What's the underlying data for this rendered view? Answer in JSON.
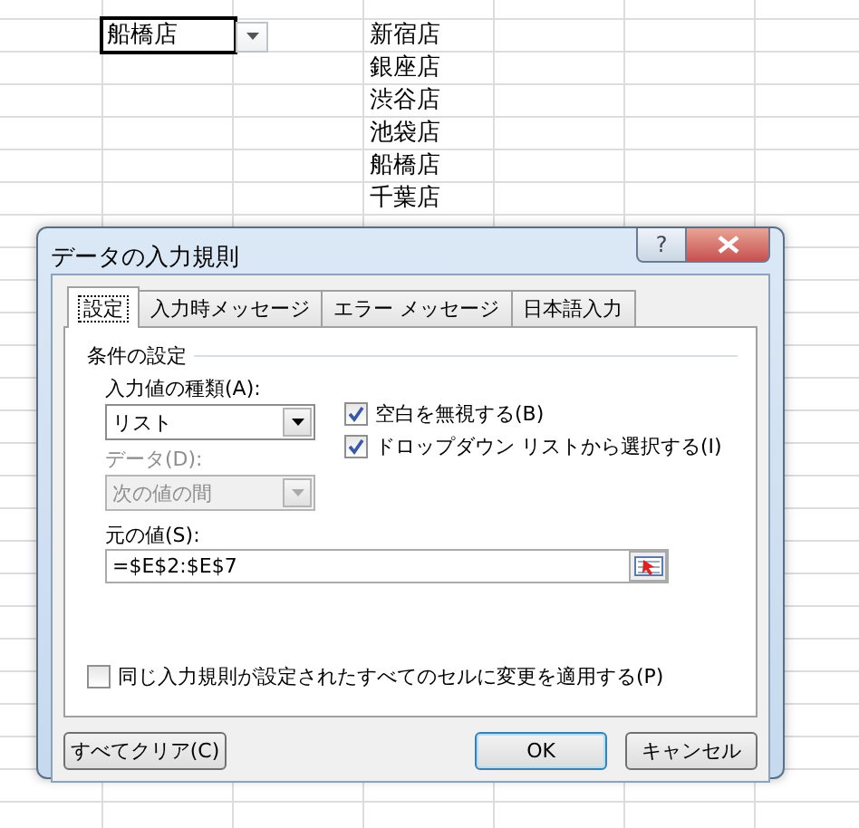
{
  "sheet": {
    "active_cell": {
      "value": "船橋店",
      "has_dropdown": true
    },
    "source_list": [
      "新宿店",
      "銀座店",
      "渋谷店",
      "池袋店",
      "船橋店",
      "千葉店"
    ]
  },
  "dialog": {
    "title": "データの入力規則",
    "help_button": "?",
    "tabs": [
      {
        "label": "設定",
        "selected": true
      },
      {
        "label": "入力時メッセージ",
        "selected": false
      },
      {
        "label": "エラー メッセージ",
        "selected": false
      },
      {
        "label": "日本語入力",
        "selected": false
      }
    ],
    "section_title": "条件の設定",
    "allow": {
      "label": "入力値の種類(A):",
      "value": "リスト"
    },
    "data": {
      "label": "データ(D):",
      "value": "次の値の間",
      "disabled": true
    },
    "options": [
      {
        "label": "空白を無視する(B)",
        "checked": true
      },
      {
        "label": "ドロップダウン リストから選択する(I)",
        "checked": true
      }
    ],
    "source": {
      "label": "元の値(S):",
      "value": "=$E$2:$E$7"
    },
    "apply_all": {
      "label": "同じ入力規則が設定されたすべてのセルに変更を適用する(P)",
      "checked": false
    },
    "buttons": [
      {
        "label": "すべてクリア(C)",
        "kind": "clear"
      },
      {
        "label": "OK",
        "kind": "default"
      },
      {
        "label": "キャンセル",
        "kind": "cancel"
      }
    ]
  }
}
